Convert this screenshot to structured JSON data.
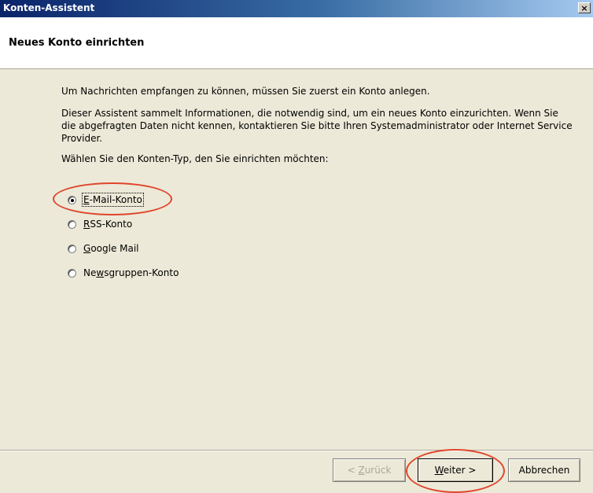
{
  "window": {
    "title": "Konten-Assistent",
    "close_glyph": "×"
  },
  "header": {
    "heading": "Neues Konto einrichten"
  },
  "content": {
    "intro": "Um Nachrichten empfangen zu können, müssen Sie zuerst ein Konto anlegen.",
    "explanation": "Dieser Assistent sammelt Informationen, die notwendig sind, um ein neues Konto einzurichten. Wenn Sie die abgefragten Daten nicht kennen, kontaktieren Sie bitte Ihren Systemadministrator oder Internet Service Provider.",
    "prompt": "Wählen Sie den Konten-Typ, den Sie einrichten möchten:"
  },
  "account_types": [
    {
      "label_before": "",
      "mnemonic": "E",
      "label_after": "-Mail-Konto",
      "checked": true
    },
    {
      "label_before": "",
      "mnemonic": "R",
      "label_after": "SS-Konto",
      "checked": false
    },
    {
      "label_before": "",
      "mnemonic": "G",
      "label_after": "oogle Mail",
      "checked": false
    },
    {
      "label_before": "Ne",
      "mnemonic": "w",
      "label_after": "sgruppen-Konto",
      "checked": false
    }
  ],
  "buttons": {
    "back": {
      "prefix": "< ",
      "mnemonic": "Z",
      "rest": "urück",
      "enabled": false
    },
    "next": {
      "prefix": "",
      "mnemonic": "W",
      "rest": "eiter >",
      "enabled": true
    },
    "cancel": {
      "label": "Abbrechen"
    }
  },
  "colors": {
    "highlight": "#e0452c",
    "titlebar_start": "#0a246a",
    "dialog_bg": "#ece9d8"
  }
}
